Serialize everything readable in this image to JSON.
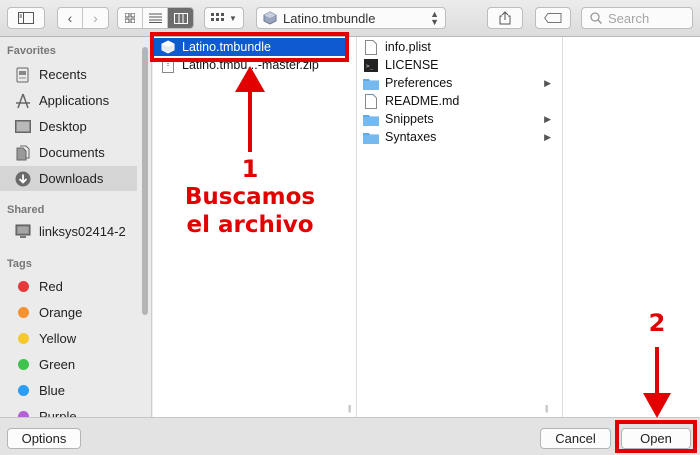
{
  "toolbar": {
    "path_label": "Latino.tmbundle",
    "search_placeholder": "Search"
  },
  "sidebar": {
    "favorites_header": "Favorites",
    "favorites": [
      "Recents",
      "Applications",
      "Desktop",
      "Documents",
      "Downloads"
    ],
    "shared_header": "Shared",
    "shared": [
      "linksys02414-2"
    ],
    "tags_header": "Tags",
    "tags": [
      {
        "label": "Red",
        "color": "#e8393a"
      },
      {
        "label": "Orange",
        "color": "#f5922f"
      },
      {
        "label": "Yellow",
        "color": "#f7c830"
      },
      {
        "label": "Green",
        "color": "#3fc34c"
      },
      {
        "label": "Blue",
        "color": "#2a9df4"
      },
      {
        "label": "Purple",
        "color": "#b65fd6"
      }
    ]
  },
  "column1": {
    "items": [
      "Latino.tmbundle",
      "Latino.tmbu...-master.zip"
    ]
  },
  "column2": {
    "items": [
      "info.plist",
      "LICENSE",
      "Preferences",
      "README.md",
      "Snippets",
      "Syntaxes"
    ]
  },
  "buttons": {
    "options": "Options",
    "cancel": "Cancel",
    "open": "Open"
  },
  "annotations": {
    "step1_number": "1",
    "step1_line1": "Buscamos",
    "step1_line2": "el archivo",
    "step2_number": "2",
    "accent_color": "#e30000"
  }
}
